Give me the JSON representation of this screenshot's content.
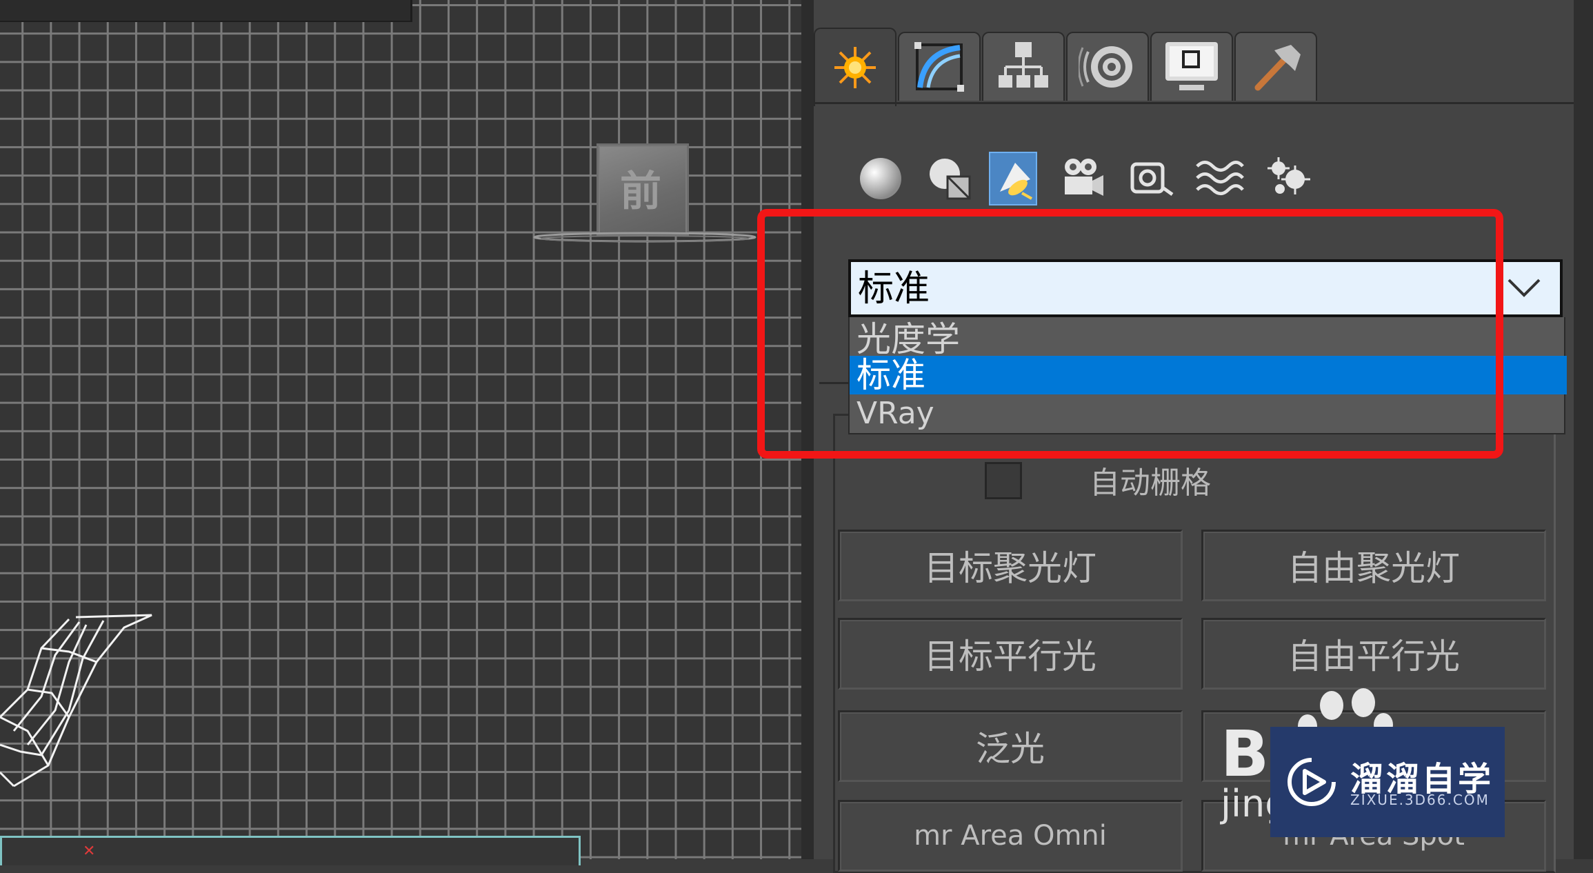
{
  "viewport": {
    "light_label": "前"
  },
  "command_panel": {
    "top_tabs": [
      {
        "icon": "create-icon",
        "active": true
      },
      {
        "icon": "modify-icon",
        "active": false
      },
      {
        "icon": "hierarchy-icon",
        "active": false
      },
      {
        "icon": "motion-icon",
        "active": false
      },
      {
        "icon": "display-icon",
        "active": false
      },
      {
        "icon": "utilities-icon",
        "active": false
      }
    ],
    "sub_categories": [
      {
        "icon": "geometry-icon",
        "active": false
      },
      {
        "icon": "shapes-icon",
        "active": false
      },
      {
        "icon": "lights-icon",
        "active": true
      },
      {
        "icon": "cameras-icon",
        "active": false
      },
      {
        "icon": "helpers-icon",
        "active": false
      },
      {
        "icon": "space-warps-icon",
        "active": false
      },
      {
        "icon": "systems-icon",
        "active": false
      }
    ],
    "light_type_dropdown": {
      "value": "标准",
      "options": [
        "光度学",
        "标准",
        "VRay"
      ],
      "selected_index": 1
    },
    "object_type": {
      "autogrid_label": "自动栅格",
      "autogrid_checked": false,
      "buttons": [
        "目标聚光灯",
        "自由聚光灯",
        "目标平行光",
        "自由平行光",
        "泛光",
        "mr Area Omni",
        "mr Area Spot"
      ]
    }
  },
  "colors": {
    "highlight": "#f21616",
    "selection": "#0078d7",
    "dropdown_bg": "#e6f2fd"
  },
  "watermarks": {
    "baidu_b": "B",
    "baidu_jing": "jing",
    "zixue_title": "溜溜自学",
    "zixue_url": "ZIXUE.3D66.COM"
  }
}
